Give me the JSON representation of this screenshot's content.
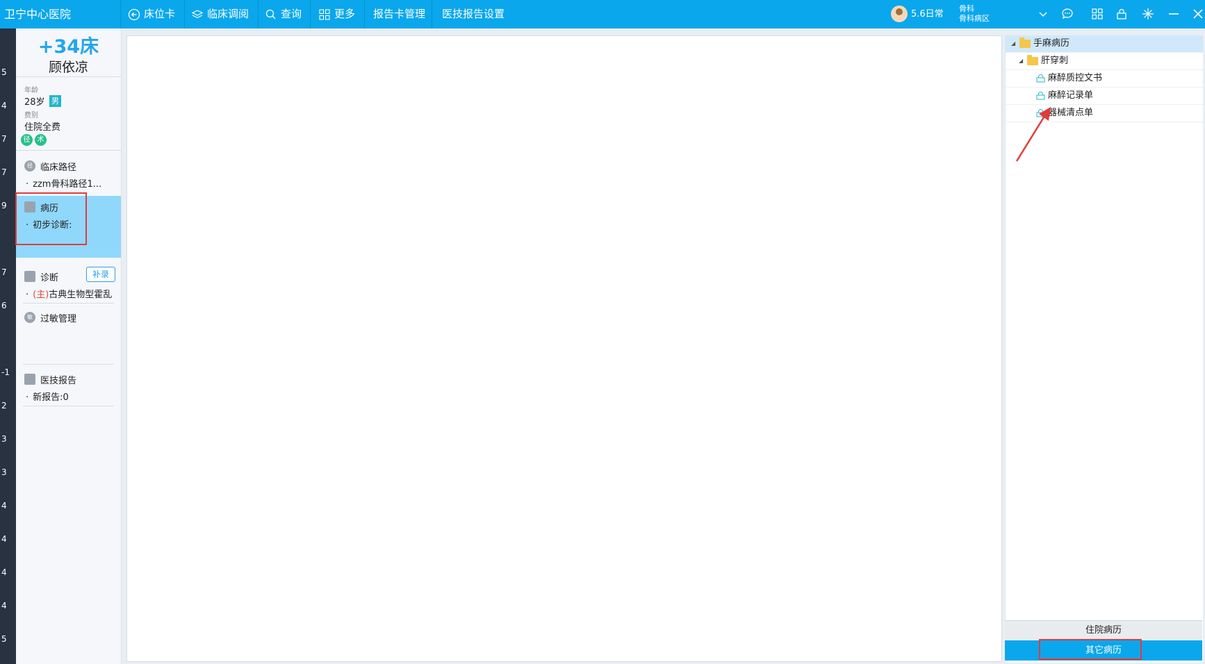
{
  "app": {
    "title": "卫宁中心医院"
  },
  "nav": [
    {
      "label": "床位卡",
      "icon": "back-arrow-icon"
    },
    {
      "label": "临床调阅",
      "icon": "layers-icon"
    },
    {
      "label": "查询",
      "icon": "search-icon"
    },
    {
      "label": "更多",
      "icon": "grid-icon"
    },
    {
      "label": "报告卡管理"
    },
    {
      "label": "医技报告设置"
    }
  ],
  "user": {
    "name": "5.6日常",
    "dept_line1": "骨科",
    "dept_line2": "骨科病区"
  },
  "left_strip": [
    "5",
    "4",
    "7",
    "7",
    "9",
    "7",
    "6",
    "-1",
    "2",
    "3",
    "3",
    "4",
    "4",
    "4",
    "4",
    "5"
  ],
  "patient": {
    "bed": "+34床",
    "name": "顾依凉",
    "age_label": "年龄",
    "age": "28岁",
    "sex": "男",
    "fee_label": "费别",
    "fee": "住院全费",
    "badges": [
      "径",
      "术"
    ]
  },
  "sections": {
    "pathway": {
      "icon_text": "径",
      "title": "临床路径",
      "item": "zzm骨科路径1..."
    },
    "record": {
      "title": "病历",
      "item": "初步诊断:"
    },
    "diagnosis": {
      "title": "诊断",
      "button": "补录",
      "item_tag": "(主)",
      "item": "古典生物型霍乱"
    },
    "allergy": {
      "icon_text": "敏",
      "title": "过敏管理"
    },
    "report": {
      "title": "医技报告",
      "item": "新报告:0"
    }
  },
  "tree": {
    "root": "手麻病历",
    "child": "肝穿刺",
    "docs": [
      "麻醉质控文书",
      "麻醉记录单",
      "器械清点单"
    ]
  },
  "tabs": {
    "inpatient": "住院病历",
    "other": "其它病历"
  },
  "colors": {
    "accent": "#0aa7ec",
    "highlight": "#8fd8fb",
    "annotation": "#e23b3b"
  }
}
